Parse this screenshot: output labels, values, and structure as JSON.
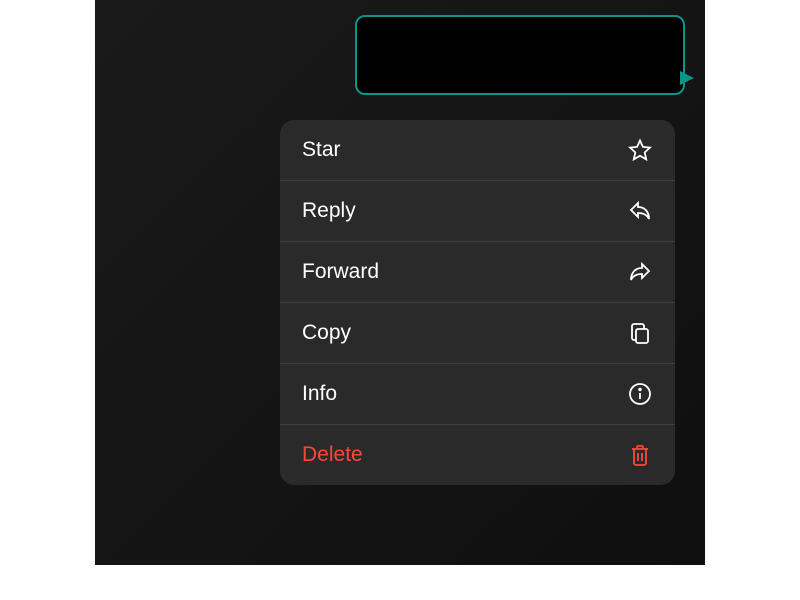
{
  "message": {
    "bubble_color": "#0d9488",
    "content_redacted": true
  },
  "context_menu": {
    "items": [
      {
        "label": "Star",
        "icon": "star-icon",
        "destructive": false
      },
      {
        "label": "Reply",
        "icon": "reply-icon",
        "destructive": false
      },
      {
        "label": "Forward",
        "icon": "forward-icon",
        "destructive": false
      },
      {
        "label": "Copy",
        "icon": "copy-icon",
        "destructive": false
      },
      {
        "label": "Info",
        "icon": "info-icon",
        "destructive": false
      },
      {
        "label": "Delete",
        "icon": "trash-icon",
        "destructive": true
      }
    ]
  }
}
